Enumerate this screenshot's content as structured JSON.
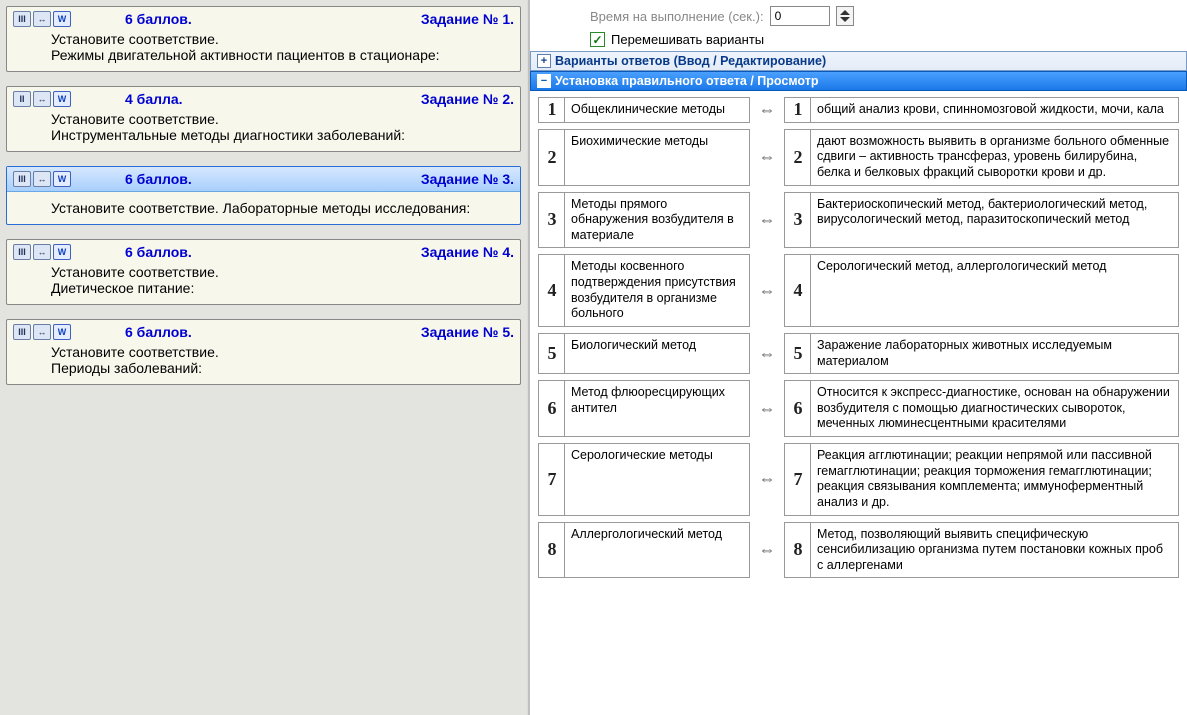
{
  "left": {
    "tasks": [
      {
        "level": "III",
        "points": "6 баллов.",
        "num": "Задание № 1.",
        "line1": "Установите соответствие.",
        "line2": "Режимы двигательной активности пациентов в стационаре:",
        "selected": false
      },
      {
        "level": "II",
        "points": "4 балла.",
        "num": "Задание № 2.",
        "line1": "Установите соответствие.",
        "line2": "Инструментальные методы диагностики заболеваний:",
        "selected": false
      },
      {
        "level": "III",
        "points": "6 баллов.",
        "num": "Задание № 3.",
        "line1": "Установите соответствие. Лабораторные методы исследования:",
        "line2": "",
        "selected": true
      },
      {
        "level": "III",
        "points": "6 баллов.",
        "num": "Задание № 4.",
        "line1": "Установите соответствие.",
        "line2": "Диетическое питание:",
        "selected": false
      },
      {
        "level": "III",
        "points": "6 баллов.",
        "num": "Задание № 5.",
        "line1": "Установите соответствие.",
        "line2": "Периоды заболеваний:",
        "selected": false
      }
    ]
  },
  "right": {
    "time_label": "Время на выполнение (сек.):",
    "time_value": "0",
    "shuffle_label": "Перемешивать варианты",
    "section_variants": "Варианты ответов (Ввод / Редактирование)",
    "section_answer": "Установка правильного ответа / Просмотр",
    "pairs": [
      {
        "n": "1",
        "left": "Общеклинические методы",
        "right": "общий анализ крови, спинномозговой жидкости, мочи, кала"
      },
      {
        "n": "2",
        "left": "Биохимические методы",
        "right": "дают возможность выявить в организме больного обменные сдвиги – активность трансфераз, уровень билирубина, белка и белковых фракций сыворотки крови и др."
      },
      {
        "n": "3",
        "left": "Методы прямого обнаружения возбудителя в материале",
        "right": "Бактериоскопический метод, бактериологический метод, вирусологический метод, паразитоскопический метод"
      },
      {
        "n": "4",
        "left": "Методы косвенного подтверждения присутствия возбудителя в организме больного",
        "right": "Серологический метод, аллергологический метод"
      },
      {
        "n": "5",
        "left": "Биологический метод",
        "right": "Заражение лабораторных животных исследуемым материалом"
      },
      {
        "n": "6",
        "left": "Метод флюоресцирующих антител",
        "right": "Относится к экспресс-диагностике, основан на обнаружении возбудителя с помощью диагностических сывороток, меченных люминесцентными красителями"
      },
      {
        "n": "7",
        "left": "Серологические методы",
        "right": "Реакция агглютинации; реакции непрямой или пассивной гемагглютинации; реакция торможения гемагглютинации; реакция связывания комплемента; иммуноферментный анализ и др."
      },
      {
        "n": "8",
        "left": "Аллергологический метод",
        "right": "Метод, позволяющий выявить специфическую сенсибилизацию организма путем постановки кожных проб с аллергенами"
      }
    ]
  }
}
